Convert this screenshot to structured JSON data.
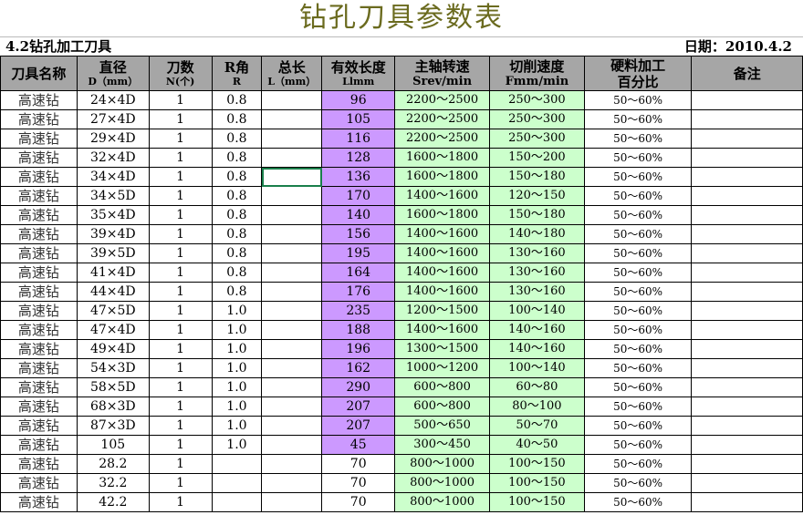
{
  "title": "钻孔刀具参数表",
  "subtitle_left": "4.2钻孔加工刀具",
  "subtitle_right": "日期：2010.4.2",
  "headers": {
    "name": {
      "line1": "刀具名称",
      "line2": ""
    },
    "diameter": {
      "line1": "直径",
      "line2": "D（mm）"
    },
    "flutes": {
      "line1": "刀数",
      "line2": "N(个)"
    },
    "radius": {
      "line1": "R角",
      "line2": "R"
    },
    "total_length": {
      "line1": "总长",
      "line2": "L（mm）"
    },
    "effective_length": {
      "line1": "有效长度",
      "line2": "Llmm"
    },
    "spindle_speed": {
      "line1": "主轴转速",
      "line2": "Srev/min"
    },
    "feed_rate": {
      "line1": "切削速度",
      "line2": "Fmm/min"
    },
    "hard_material": {
      "line1": "硬料加工",
      "line2": "百分比"
    },
    "notes": {
      "line1": "备注",
      "line2": ""
    }
  },
  "rows": [
    {
      "name": "高速钻",
      "diameter": "24×4D",
      "flutes": "1",
      "radius": "0.8",
      "total_length": "",
      "effective_length": "96",
      "spindle_speed": "2200～2500",
      "feed_rate": "250～300",
      "hard_material": "50～60%",
      "notes": ""
    },
    {
      "name": "高速钻",
      "diameter": "27×4D",
      "flutes": "1",
      "radius": "0.8",
      "total_length": "",
      "effective_length": "105",
      "spindle_speed": "2200～2500",
      "feed_rate": "250～300",
      "hard_material": "50～60%",
      "notes": ""
    },
    {
      "name": "高速钻",
      "diameter": "29×4D",
      "flutes": "1",
      "radius": "0.8",
      "total_length": "",
      "effective_length": "116",
      "spindle_speed": "2200～2500",
      "feed_rate": "250～300",
      "hard_material": "50～60%",
      "notes": ""
    },
    {
      "name": "高速钻",
      "diameter": "32×4D",
      "flutes": "1",
      "radius": "0.8",
      "total_length": "",
      "effective_length": "128",
      "spindle_speed": "1600～1800",
      "feed_rate": "150～200",
      "hard_material": "50～60%",
      "notes": ""
    },
    {
      "name": "高速钻",
      "diameter": "34×4D",
      "flutes": "1",
      "radius": "0.8",
      "total_length": "",
      "effective_length": "136",
      "spindle_speed": "1600～1800",
      "feed_rate": "150～180",
      "hard_material": "50～60%",
      "notes": ""
    },
    {
      "name": "高速钻",
      "diameter": "34×5D",
      "flutes": "1",
      "radius": "0.8",
      "total_length": "",
      "effective_length": "170",
      "spindle_speed": "1400～1600",
      "feed_rate": "120～150",
      "hard_material": "50～60%",
      "notes": ""
    },
    {
      "name": "高速钻",
      "diameter": "35×4D",
      "flutes": "1",
      "radius": "0.8",
      "total_length": "",
      "effective_length": "140",
      "spindle_speed": "1600～1800",
      "feed_rate": "150～180",
      "hard_material": "50～60%",
      "notes": ""
    },
    {
      "name": "高速钻",
      "diameter": "39×4D",
      "flutes": "1",
      "radius": "0.8",
      "total_length": "",
      "effective_length": "156",
      "spindle_speed": "1400～1600",
      "feed_rate": "140～180",
      "hard_material": "50～60%",
      "notes": ""
    },
    {
      "name": "高速钻",
      "diameter": "39×5D",
      "flutes": "1",
      "radius": "0.8",
      "total_length": "",
      "effective_length": "195",
      "spindle_speed": "1400～1600",
      "feed_rate": "130～160",
      "hard_material": "50～60%",
      "notes": ""
    },
    {
      "name": "高速钻",
      "diameter": "41×4D",
      "flutes": "1",
      "radius": "0.8",
      "total_length": "",
      "effective_length": "164",
      "spindle_speed": "1400～1600",
      "feed_rate": "130～160",
      "hard_material": "50～60%",
      "notes": ""
    },
    {
      "name": "高速钻",
      "diameter": "44×4D",
      "flutes": "1",
      "radius": "0.8",
      "total_length": "",
      "effective_length": "176",
      "spindle_speed": "1400～1600",
      "feed_rate": "130～160",
      "hard_material": "50～60%",
      "notes": ""
    },
    {
      "name": "高速钻",
      "diameter": "47×5D",
      "flutes": "1",
      "radius": "1.0",
      "total_length": "",
      "effective_length": "235",
      "spindle_speed": "1200～1500",
      "feed_rate": "100～140",
      "hard_material": "50～60%",
      "notes": ""
    },
    {
      "name": "高速钻",
      "diameter": "47×4D",
      "flutes": "1",
      "radius": "1.0",
      "total_length": "",
      "effective_length": "188",
      "spindle_speed": "1400～1600",
      "feed_rate": "140～160",
      "hard_material": "50～60%",
      "notes": ""
    },
    {
      "name": "高速钻",
      "diameter": "49×4D",
      "flutes": "1",
      "radius": "1.0",
      "total_length": "",
      "effective_length": "196",
      "spindle_speed": "1300～1500",
      "feed_rate": "140～160",
      "hard_material": "50～60%",
      "notes": ""
    },
    {
      "name": "高速钻",
      "diameter": "54×3D",
      "flutes": "1",
      "radius": "1.0",
      "total_length": "",
      "effective_length": "162",
      "spindle_speed": "1000～1200",
      "feed_rate": "100～140",
      "hard_material": "50～60%",
      "notes": ""
    },
    {
      "name": "高速钻",
      "diameter": "58×5D",
      "flutes": "1",
      "radius": "1.0",
      "total_length": "",
      "effective_length": "290",
      "spindle_speed": "600～800",
      "feed_rate": "60～80",
      "hard_material": "50～60%",
      "notes": ""
    },
    {
      "name": "高速钻",
      "diameter": "68×3D",
      "flutes": "1",
      "radius": "1.0",
      "total_length": "",
      "effective_length": "207",
      "spindle_speed": "600～800",
      "feed_rate": "80～100",
      "hard_material": "50～60%",
      "notes": ""
    },
    {
      "name": "高速钻",
      "diameter": "87×3D",
      "flutes": "1",
      "radius": "1.0",
      "total_length": "",
      "effective_length": "207",
      "spindle_speed": "500～650",
      "feed_rate": "50～70",
      "hard_material": "50～60%",
      "notes": ""
    },
    {
      "name": "高速钻",
      "diameter": "105",
      "flutes": "1",
      "radius": "1.0",
      "total_length": "",
      "effective_length": "45",
      "spindle_speed": "300～450",
      "feed_rate": "40～50",
      "hard_material": "50～60%",
      "notes": ""
    },
    {
      "name": "高速钻",
      "diameter": "28.2",
      "flutes": "1",
      "radius": "",
      "total_length": "",
      "effective_length": "70",
      "spindle_speed": "800～1000",
      "feed_rate": "100～150",
      "hard_material": "50～60%",
      "notes": ""
    },
    {
      "name": "高速钻",
      "diameter": "32.2",
      "flutes": "1",
      "radius": "",
      "total_length": "",
      "effective_length": "70",
      "spindle_speed": "800～1000",
      "feed_rate": "100～150",
      "hard_material": "50～60%",
      "notes": ""
    },
    {
      "name": "高速钻",
      "diameter": "42.2",
      "flutes": "1",
      "radius": "",
      "total_length": "",
      "effective_length": "70",
      "spindle_speed": "800～1000",
      "feed_rate": "100～150",
      "hard_material": "50～60%",
      "notes": ""
    }
  ],
  "colors": {
    "header_bg": "#a6a6a6",
    "effective_length_bg": "#cc99ff",
    "speed_bg": "#ccffcc",
    "title_color": "#6b6b1f",
    "selection_border": "#1a7f4b"
  }
}
